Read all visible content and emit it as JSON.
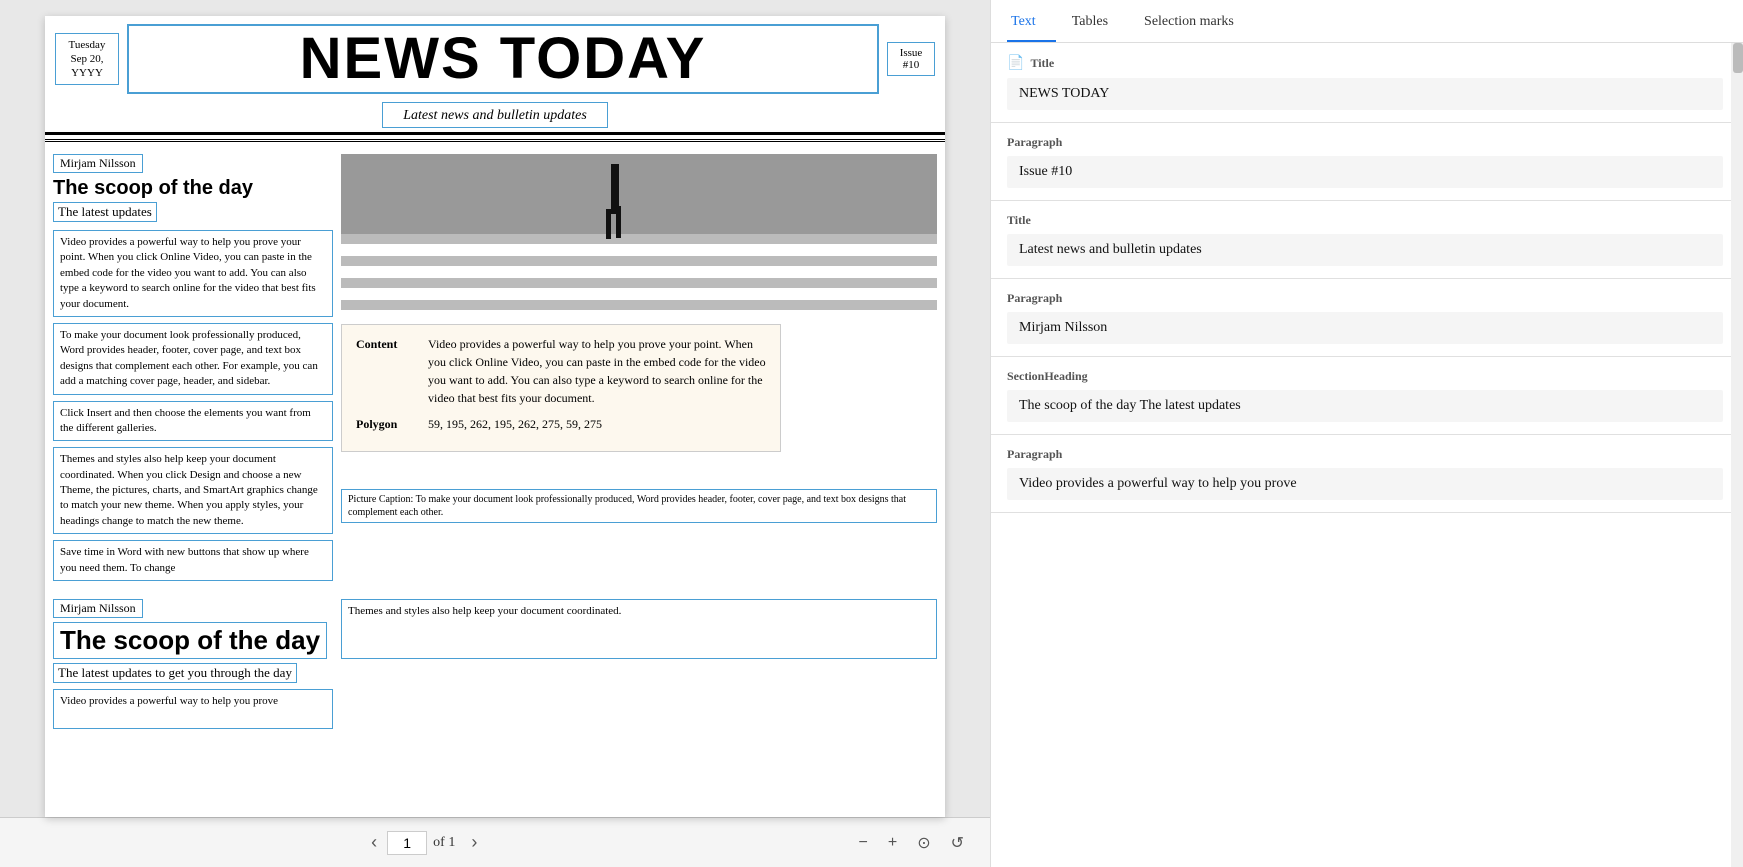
{
  "document": {
    "date": "Tuesday\nSep 20,\nYYYY",
    "masthead": "NEWS TODAY",
    "issue": "Issue\n#10",
    "subtitle": "Latest news and bulletin updates",
    "author1": "Mirjam Nilsson",
    "heading1": "The scoop of the day",
    "subheading1": "The latest updates",
    "body1": "Video provides a powerful way to help you prove your point. When you click Online Video, you can paste in the embed code for the video you want to add. You can also type a keyword to search online for the video that best fits your document.",
    "body2": "To make your document look professionally produced, Word provides header, footer, cover page, and text box designs that complement each other. For example, you can add a matching cover page, header, and sidebar.",
    "body3": "Click Insert and then choose the elements you want from the different galleries.",
    "body4": "Themes and styles also help keep your document coordinated. When you click Design and choose a new Theme, the pictures, charts, and SmartArt graphics change to match your new theme. When you apply styles, your headings change to match the new theme.",
    "body5": "Save time in Word with new buttons that show up where you need them. To change",
    "tooltip_label1": "Content",
    "tooltip_value1": "Video provides a powerful way to help you prove your point. When you click Online Video, you can paste in the embed code for the video you want to add. You can also type a keyword to search online for the video that best fits your document.",
    "tooltip_label2": "Polygon",
    "tooltip_value2": "59, 195, 262, 195, 262, 275, 59, 275",
    "caption": "Picture Caption: To make your document look professionally produced, Word provides header, footer, cover page, and text box designs that complement each other.",
    "author2": "Mirjam Nilsson",
    "heading2": "The scoop of the day",
    "subheading2": "The latest updates to get you through the day",
    "partial_text": "Video provides a powerful way to help you prove",
    "themes_text": "Themes and styles also help keep your document coordinated.",
    "page_current": "1",
    "page_of": "of 1"
  },
  "right_panel": {
    "tabs": [
      {
        "label": "Text",
        "active": true
      },
      {
        "label": "Tables",
        "active": false
      },
      {
        "label": "Selection marks",
        "active": false
      }
    ],
    "sections": [
      {
        "label": "Title",
        "icon": "📄",
        "value": "NEWS TODAY"
      },
      {
        "label": "Paragraph",
        "icon": "",
        "value": "Issue #10"
      },
      {
        "label": "Title",
        "icon": "",
        "value": "Latest news and bulletin updates"
      },
      {
        "label": "Paragraph",
        "icon": "",
        "value": "Mirjam Nilsson"
      },
      {
        "label": "SectionHeading",
        "icon": "",
        "value": "The scoop of the day The latest updates"
      },
      {
        "label": "Paragraph",
        "icon": "",
        "value": "Video provides a powerful way to help you prove"
      }
    ]
  },
  "toolbar": {
    "prev_label": "‹",
    "next_label": "›",
    "zoom_out": "−",
    "zoom_in": "+",
    "fit_page": "⊙",
    "rotate": "↺"
  }
}
